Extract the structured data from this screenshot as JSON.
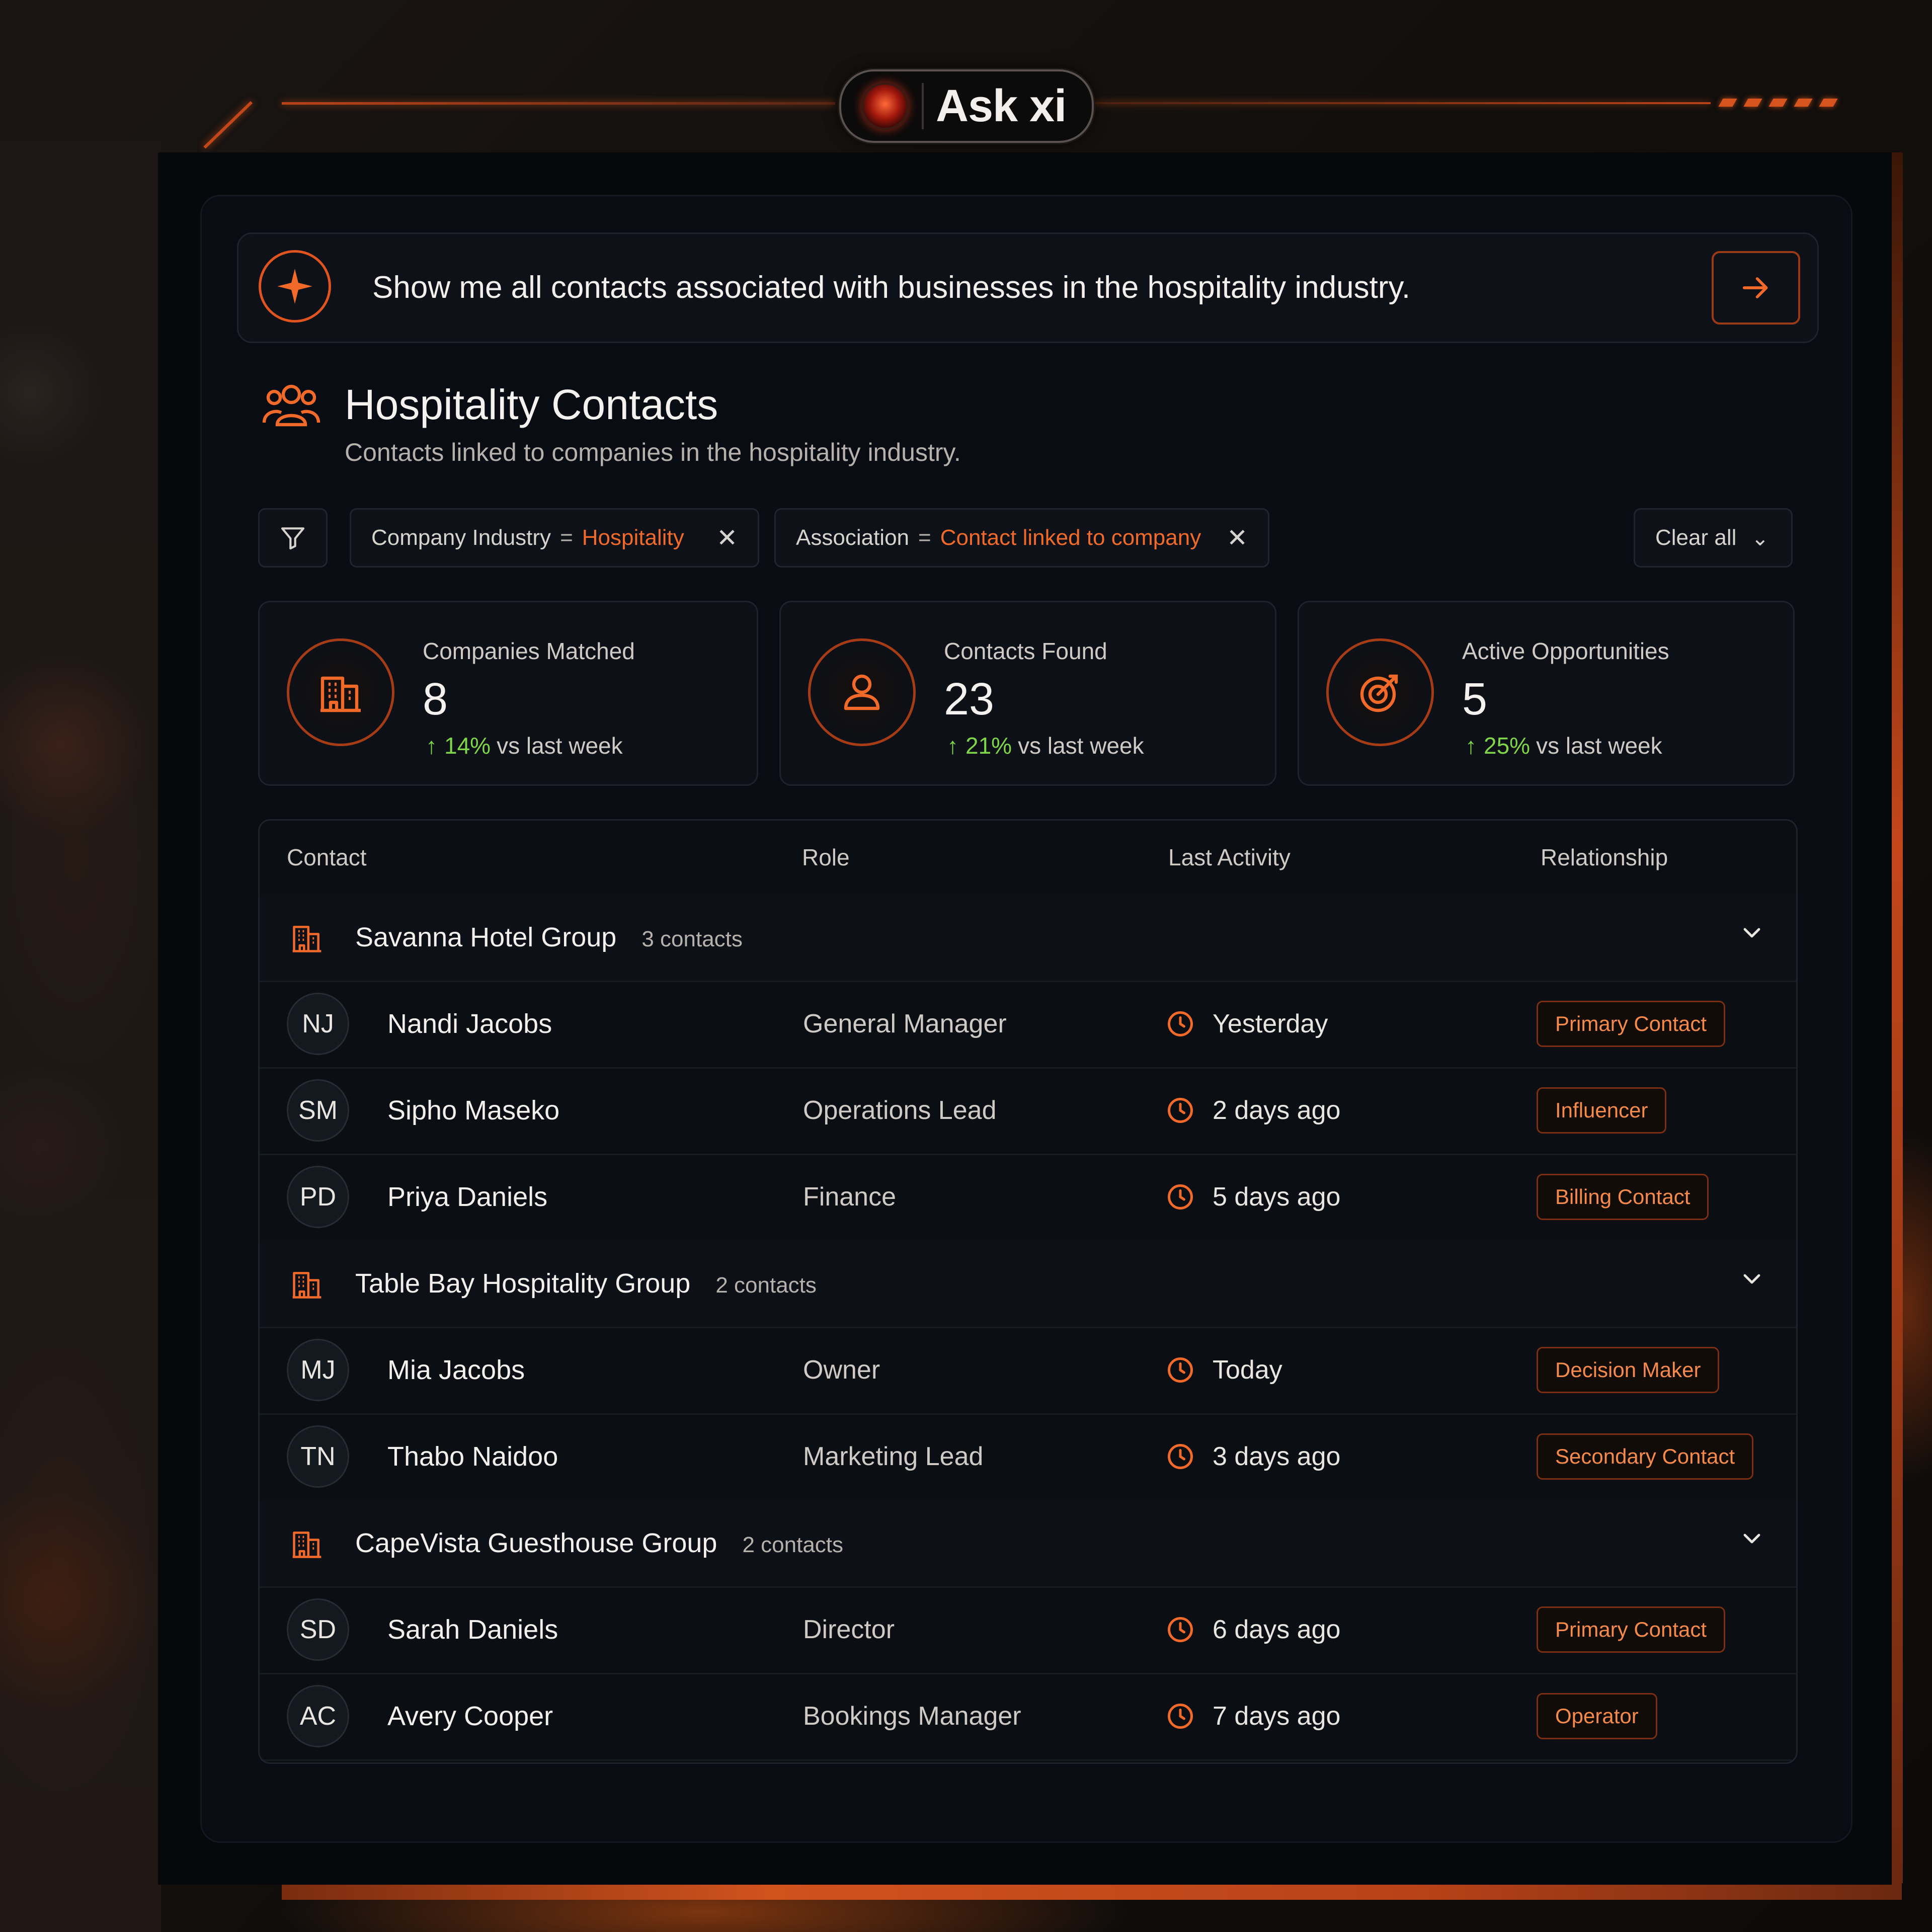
{
  "brand": {
    "title": "Ask xi"
  },
  "query": {
    "text": "Show me all contacts associated with businesses in the hospitality industry.",
    "send_icon": "arrow-right-icon",
    "spark_icon": "sparkle-icon"
  },
  "section": {
    "title": "Hospitality Contacts",
    "subtitle": "Contacts linked to companies in the hospitality industry."
  },
  "filters": {
    "chips": [
      {
        "field": "Company Industry",
        "op": "=",
        "value": "Hospitality"
      },
      {
        "field": "Association",
        "op": "=",
        "value": "Contact linked to company"
      }
    ],
    "clear_label": "Clear all"
  },
  "stats": [
    {
      "label": "Companies Matched",
      "value": "8",
      "pct": "14%",
      "suffix": "vs last week",
      "icon": "building-icon"
    },
    {
      "label": "Contacts Found",
      "value": "23",
      "pct": "21%",
      "suffix": "vs last week",
      "icon": "user-icon"
    },
    {
      "label": "Active Opportunities",
      "value": "5",
      "pct": "25%",
      "suffix": "vs last week",
      "icon": "target-icon"
    }
  ],
  "table": {
    "columns": [
      "Contact",
      "Role",
      "Last Activity",
      "Relationship"
    ],
    "groups": [
      {
        "name": "Savanna Hotel Group",
        "count": "3 contacts",
        "contacts": [
          {
            "initials": "NJ",
            "name": "Nandi Jacobs",
            "role": "General Manager",
            "activity": "Yesterday",
            "relationship": "Primary Contact"
          },
          {
            "initials": "SM",
            "name": "Sipho Maseko",
            "role": "Operations Lead",
            "activity": "2 days ago",
            "relationship": "Influencer"
          },
          {
            "initials": "PD",
            "name": "Priya Daniels",
            "role": "Finance",
            "activity": "5 days ago",
            "relationship": "Billing Contact"
          }
        ]
      },
      {
        "name": "Table Bay Hospitality Group",
        "count": "2 contacts",
        "contacts": [
          {
            "initials": "MJ",
            "name": "Mia Jacobs",
            "role": "Owner",
            "activity": "Today",
            "relationship": "Decision Maker"
          },
          {
            "initials": "TN",
            "name": "Thabo Naidoo",
            "role": "Marketing Lead",
            "activity": "3 days ago",
            "relationship": "Secondary Contact"
          }
        ]
      },
      {
        "name": "CapeVista Guesthouse Group",
        "count": "2 contacts",
        "contacts": [
          {
            "initials": "SD",
            "name": "Sarah Daniels",
            "role": "Director",
            "activity": "6 days ago",
            "relationship": "Primary Contact"
          },
          {
            "initials": "AC",
            "name": "Avery Cooper",
            "role": "Bookings Manager",
            "activity": "7 days ago",
            "relationship": "Operator"
          }
        ]
      }
    ]
  },
  "colors": {
    "accent": "#f26a2a",
    "positive": "#7fd64a",
    "panel": "#090c12",
    "background": "#06080c"
  }
}
